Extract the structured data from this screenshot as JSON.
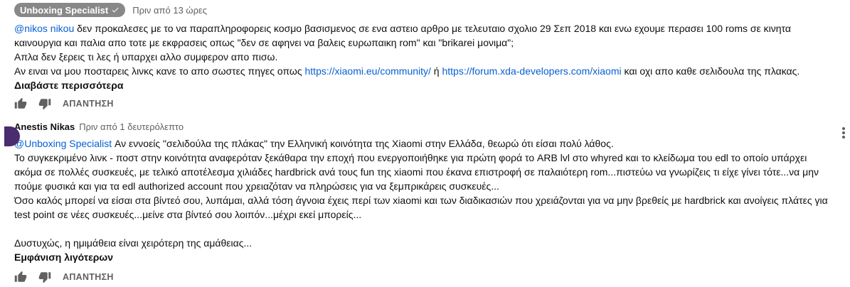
{
  "comment1": {
    "author": "Unboxing Specialist",
    "time": "Πριν από 13 ώρες",
    "mention": "@nikos nikou",
    "line1_rest": " δεν προκαλεσες με το να παραπληροφορεις κοσμο βασισμενος σε ενα αστειο αρθρο με τελευταιο σχολιο 29 Σεπ  2018 και ενω εχουμε περασει 100 roms σε κινητα",
    "line2": "καινουργια και παλια απο τοτε με εκφρασεις οπως \"δεν σε αφηνει να βαλεις ευρωπαικη rom\" και \"brikarei μονιμα\";",
    "line3": "Απλα δεν ξερεις τι λες ή υπαρχει αλλο συμφερον απο πισω.",
    "line4_start": "Αν ειναι να μου ποσταρεις λινκς κανε το απο σωστες πηγες οπως ",
    "link1": "https://xiaomi.eu/community/",
    "line4_mid": " ή ",
    "link2": "https://forum.xda-developers.com/xiaomi",
    "line4_end": " και οχι απο καθε σελιδουλα της πλακας.",
    "read_more": "Διαβάστε περισσότερα",
    "reply": "ΑΠΑΝΤΗΣΗ"
  },
  "comment2": {
    "author": "Anestis Nikas",
    "time": "Πριν από 1 δευτερόλεπτο",
    "mention": "@Unboxing Specialist",
    "line1_rest": "  Αν εννοείς \"σελιδούλα της πλάκας\" την Ελληνική κοινότητα της Xiaomi στην Ελλάδα, θεωρώ ότι είσαι πολύ λάθος.",
    "para2": "Το συγκεκριμένο λινκ - ποστ στην κοινότητα αναφερόταν ξεκάθαρα την εποχή που ενεργοποιήθηκε για πρώτη φορά το ARB lvl στο whyred και το κλείδωμα του edl το οποίο υπάρχει ακόμα σε πολλές συσκευές, με τελικό αποτέλεσμα χιλιάδες hardbrick ανά τους fun της xiaomi που έκανα επιστροφή σε παλαιότερη rom...πιστεύω να γνωρίζεις τι είχε γίνει τότε...να μην πούμε φυσικά και για τα edl authorized account που χρειαζόταν να πληρώσεις για να ξεμπρικάρεις συσκευές...",
    "para3": "Όσο καλός μπορεί να είσαι στα βίντεό σου, λυπάμαι, αλλά τόση άγνοια έχεις περί των xiaomi και των διαδικασιών που χρειάζονται για να μην βρεθείς με hardbrick και ανοίγεις πλάτες για test point σε νέες συσκευές...μείνε στα βίντεό σου λοιπόν...μέχρι εκεί μπορείς...",
    "para4": "Δυστυχώς, η ημιμάθεια είναι χειρότερη της αμάθειας...",
    "show_less": "Εμφάνιση λιγότερων",
    "reply": "ΑΠΑΝΤΗΣΗ"
  },
  "icons": {
    "like": "thumb-up-icon",
    "dislike": "thumb-down-icon",
    "verified": "check-icon",
    "menu": "more-vert-icon"
  },
  "colors": {
    "badge": "#888888",
    "link": "#065fd4",
    "secondary_text": "#606060",
    "avatar": "#4a2c6f"
  }
}
